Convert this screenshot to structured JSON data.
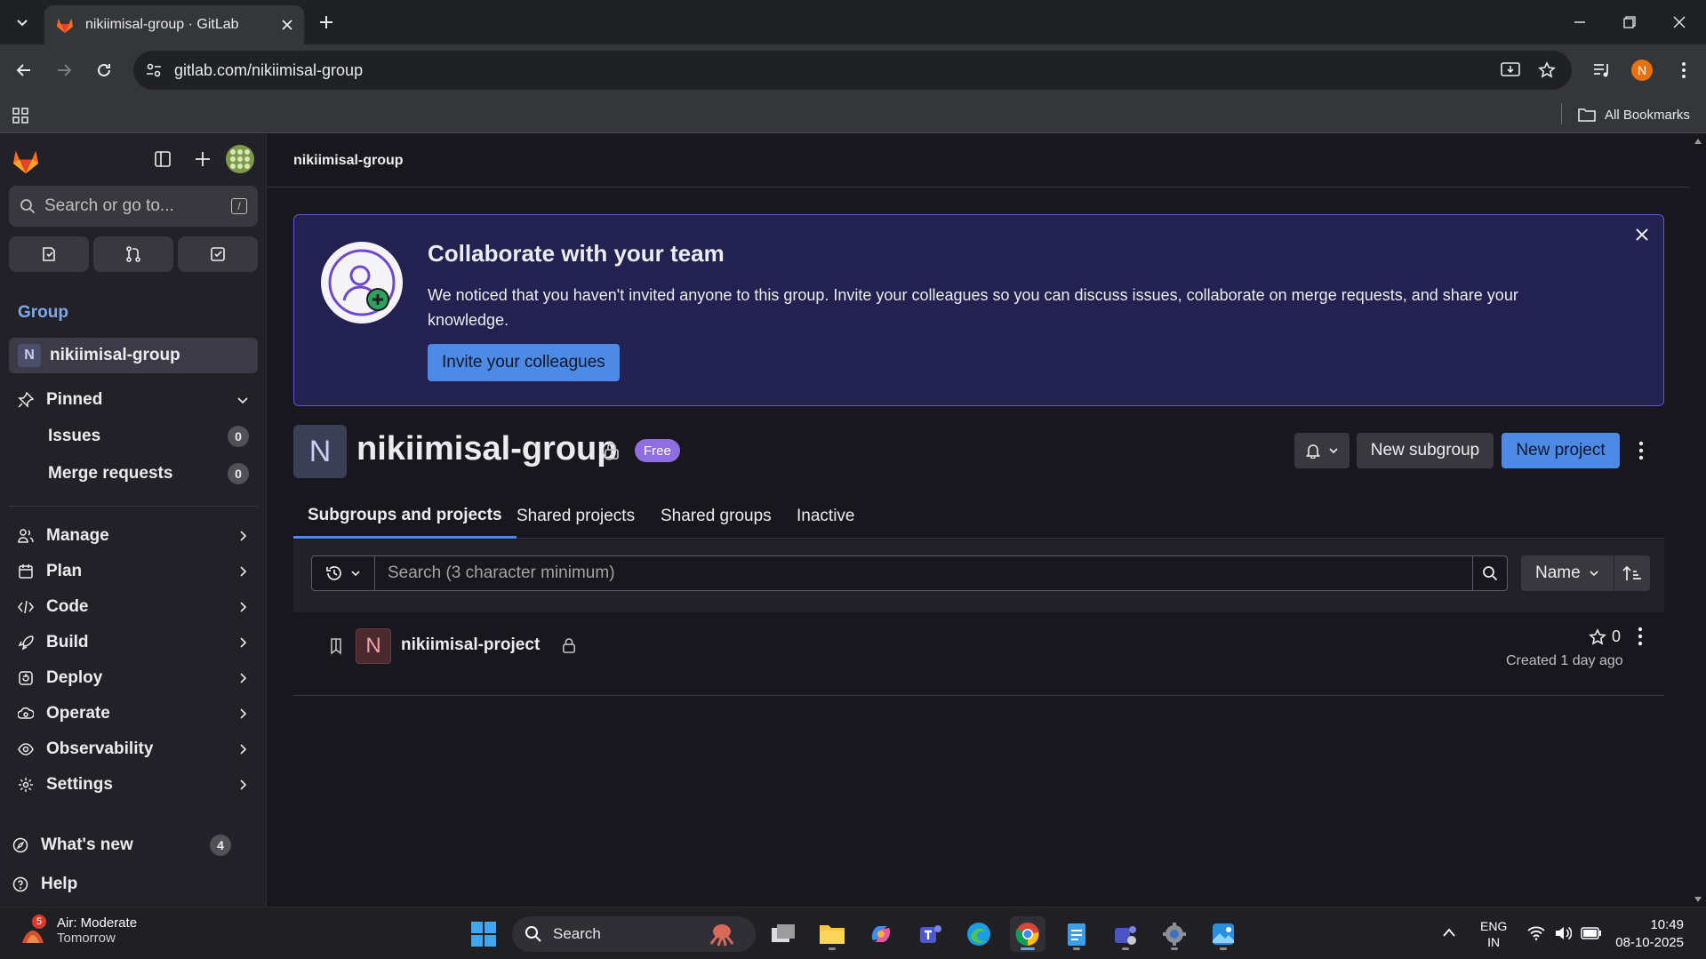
{
  "browser": {
    "tab_title": "nikiimisal-group · GitLab",
    "url": "gitlab.com/nikiimisal-group",
    "all_bookmarks": "All Bookmarks",
    "profile_initial": "N"
  },
  "sidebar": {
    "search_placeholder": "Search or go to...",
    "search_shortcut": "/",
    "context_heading": "Group",
    "group_initial": "N",
    "group_name": "nikiimisal-group",
    "pinned_label": "Pinned",
    "pinned_items": [
      {
        "label": "Issues",
        "count": "0"
      },
      {
        "label": "Merge requests",
        "count": "0"
      }
    ],
    "nav_items": [
      {
        "label": "Manage"
      },
      {
        "label": "Plan"
      },
      {
        "label": "Code"
      },
      {
        "label": "Build"
      },
      {
        "label": "Deploy"
      },
      {
        "label": "Operate"
      },
      {
        "label": "Observability"
      },
      {
        "label": "Settings"
      }
    ],
    "whats_new": "What's new",
    "whats_new_count": "4",
    "help": "Help"
  },
  "main": {
    "breadcrumb": "nikiimisal-group",
    "banner": {
      "title": "Collaborate with your team",
      "text": "We noticed that you haven't invited anyone to this group. Invite your colleagues so you can discuss issues, collaborate on merge requests, and share your knowledge.",
      "button": "Invite your colleagues"
    },
    "group": {
      "initial": "N",
      "name": "nikiimisal-group",
      "plan_badge": "Free"
    },
    "actions": {
      "new_subgroup": "New subgroup",
      "new_project": "New project"
    },
    "tabs": [
      {
        "label": "Subgroups and projects",
        "active": true
      },
      {
        "label": "Shared projects",
        "active": false
      },
      {
        "label": "Shared groups",
        "active": false
      },
      {
        "label": "Inactive",
        "active": false
      }
    ],
    "filter": {
      "placeholder": "Search (3 character minimum)",
      "sort_label": "Name"
    },
    "projects": [
      {
        "initial": "N",
        "name": "nikiimisal-project",
        "stars": "0",
        "created": "Created 1 day ago"
      }
    ]
  },
  "taskbar": {
    "weather_title": "Air: Moderate",
    "weather_sub": "Tomorrow",
    "weather_badge": "5",
    "search_label": "Search",
    "lang_top": "ENG",
    "lang_bottom": "IN",
    "time": "10:49",
    "date": "08-10-2025"
  },
  "colors": {
    "accent_blue": "#4c8ae6",
    "banner_bg": "#232150",
    "free_badge": "#8e6ee0",
    "gitlab_orange": "#fc6d26"
  }
}
